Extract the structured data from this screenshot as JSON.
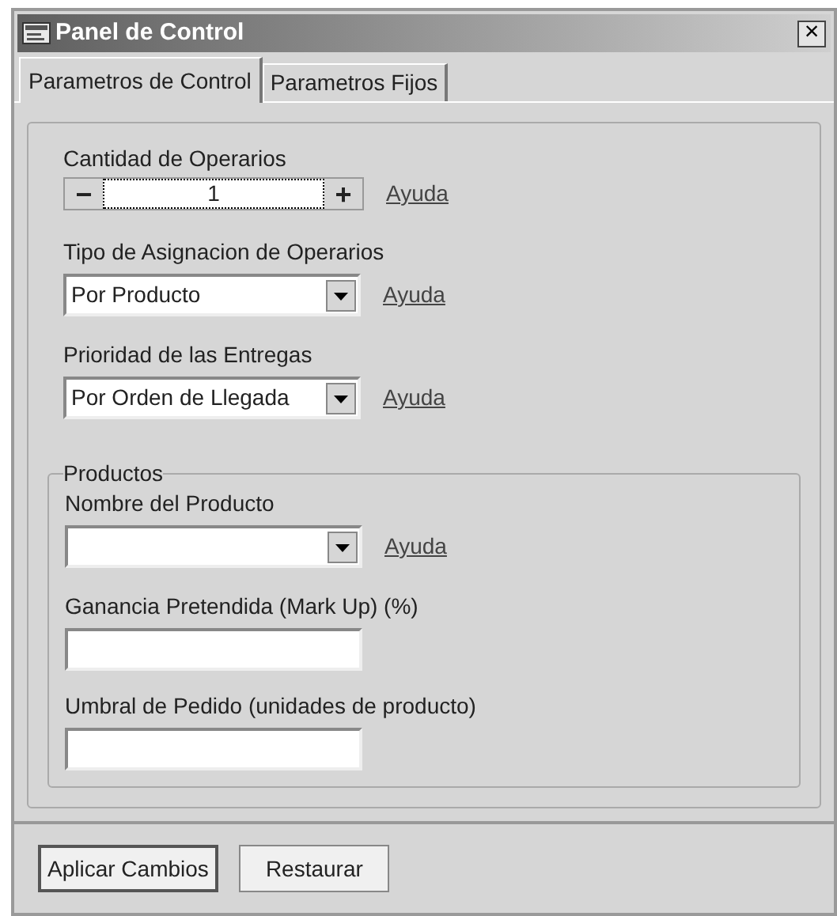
{
  "window": {
    "title": "Panel de Control",
    "close": "×"
  },
  "tabs": [
    {
      "label": "Parametros de Control",
      "selected": true
    },
    {
      "label": "Parametros Fijos",
      "selected": false
    }
  ],
  "operators": {
    "label": "Cantidad de Operarios",
    "minus": "−",
    "value": "1",
    "plus": "+",
    "help": "Ayuda"
  },
  "assignment": {
    "label": "Tipo de Asignacion de Operarios",
    "value": "Por Producto",
    "help": "Ayuda"
  },
  "priority": {
    "label": "Prioridad de las Entregas",
    "value": "Por Orden de Llegada",
    "help": "Ayuda"
  },
  "products": {
    "title": "Productos",
    "name": {
      "label": "Nombre del Producto",
      "help": "Ayuda"
    },
    "markup": {
      "label": "Ganancia Pretendida (Mark Up) (%)"
    },
    "threshold": {
      "label": "Umbral de Pedido (unidades de producto)"
    }
  },
  "buttons": [
    {
      "label": "Aplicar Cambios",
      "default": true
    },
    {
      "label": "Restaurar",
      "default": false
    }
  ]
}
